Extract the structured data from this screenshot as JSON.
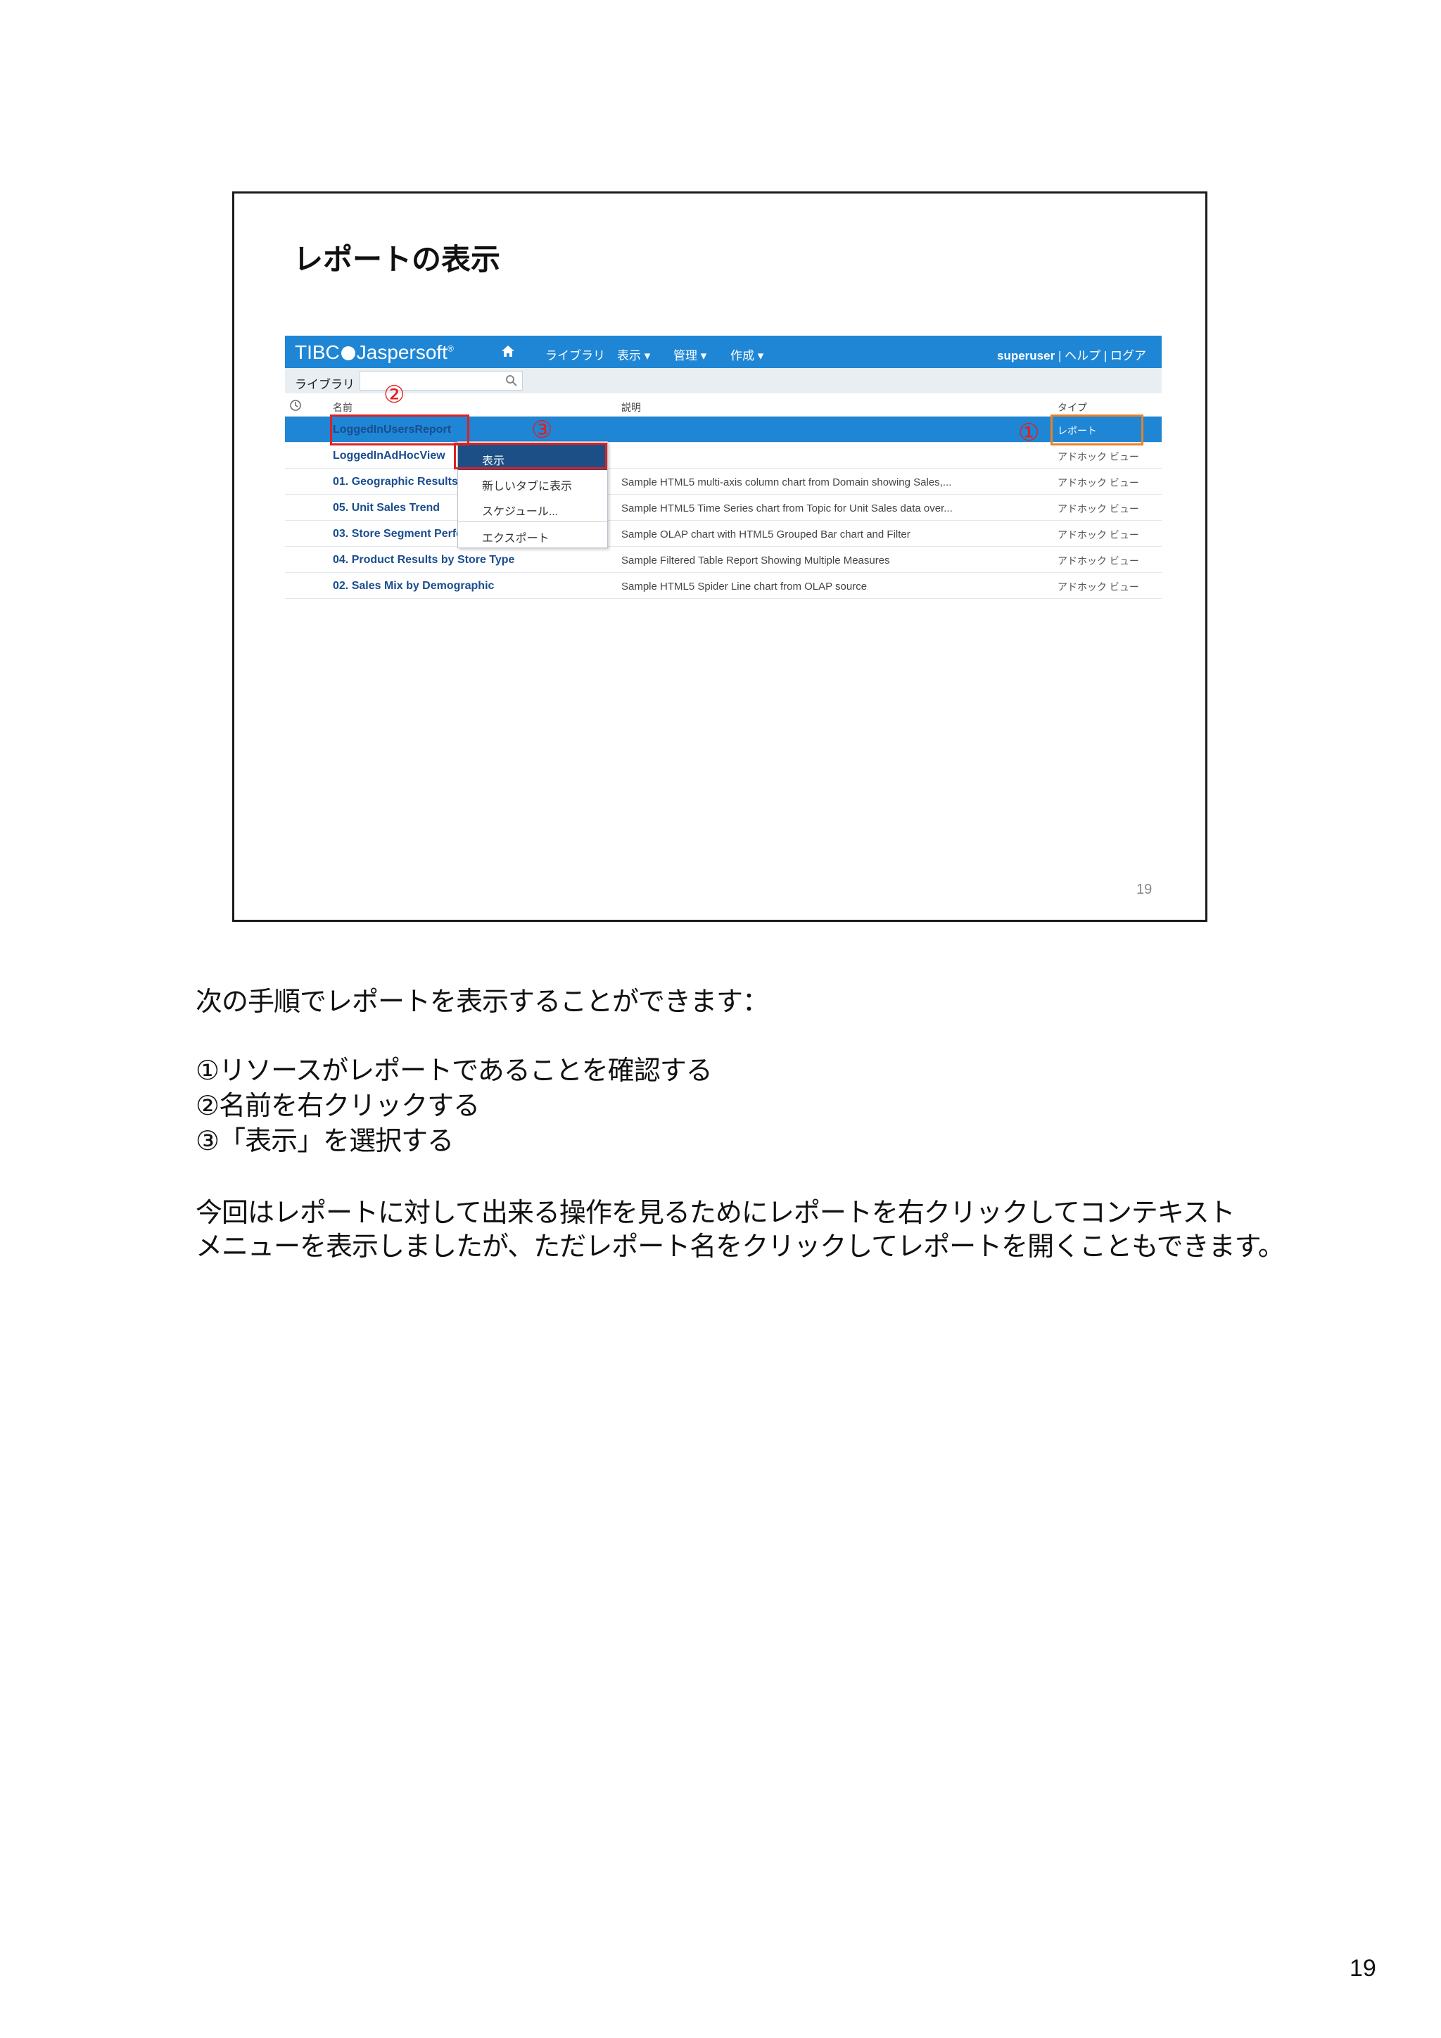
{
  "slide": {
    "title": "レポートの表示",
    "number": "19"
  },
  "app": {
    "logo": {
      "prefix": "TIBC",
      "suffix": "Jaspersoft",
      "mark": "®"
    },
    "nav": [
      "ライブラリ",
      "表示 ▾",
      "管理 ▾",
      "作成 ▾"
    ],
    "user": "superuser",
    "help": "ヘルプ",
    "logout": "ログア",
    "subbar_label": "ライブラリ",
    "search": {
      "value": "",
      "placeholder": ""
    },
    "columns": {
      "name": "名前",
      "description": "説明",
      "type": "タイプ"
    },
    "rows": [
      {
        "name": "LoggedInUsersReport",
        "description": "",
        "type": "レポート"
      },
      {
        "name": "LoggedInAdHocView",
        "description": "",
        "type": "アドホック ビュー"
      },
      {
        "name": "01. Geographic Results by Segment",
        "description": "Sample HTML5 multi-axis column chart from Domain showing Sales,...",
        "type": "アドホック ビュー"
      },
      {
        "name": "05. Unit Sales Trend",
        "description": "Sample HTML5 Time Series chart from Topic for Unit Sales data over...",
        "type": "アドホック ビュー"
      },
      {
        "name": "03. Store Segment Performance",
        "description": "Sample OLAP chart with HTML5 Grouped Bar chart and Filter",
        "type": "アドホック ビュー"
      },
      {
        "name": "04. Product Results by Store Type",
        "description": "Sample Filtered Table Report Showing Multiple Measures",
        "type": "アドホック ビュー"
      },
      {
        "name": "02. Sales Mix by Demographic",
        "description": "Sample HTML5 Spider Line chart from OLAP source",
        "type": "アドホック ビュー"
      }
    ],
    "context_menu": [
      "表示",
      "新しいタブに表示",
      "スケジュール...",
      "エクスポート"
    ],
    "markers": [
      "②",
      "③",
      "①"
    ]
  },
  "notes": {
    "intro": "次の手順でレポートを表示することができます：",
    "steps": [
      "①リソースがレポートであることを確認する",
      "②名前を右クリックする",
      "③「表示」を選択する"
    ],
    "para_line1": "今回はレポートに対して出来る操作を見るためにレポートを右クリックしてコンテキスト",
    "para_line2": "メニューを表示しましたが、ただレポート名をクリックしてレポートを開くこともできます。"
  },
  "page_number": "19",
  "colors": {
    "topbar": "#1e86d5",
    "selected_row": "#1e86d5",
    "menu_active": "#1b4f86",
    "annotation_red": "#e02020",
    "annotation_orange": "#e8822a"
  }
}
